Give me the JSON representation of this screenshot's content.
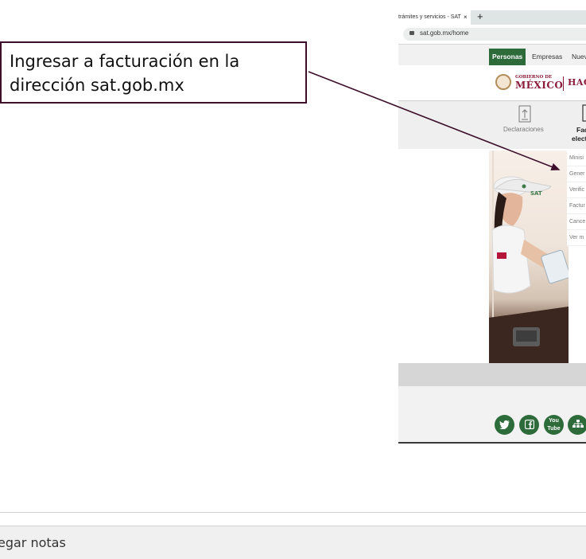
{
  "callout": {
    "line1": "Ingresar a facturación en la",
    "line2": "dirección sat.gob.mx"
  },
  "browser": {
    "tab_title": "trámites y servicios - SAT",
    "tab_close": "×",
    "new_tab": "+",
    "url": "sat.gob.mx/home"
  },
  "site": {
    "top_links": [
      "Personas",
      "Empresas",
      "Nuev"
    ],
    "gov_line1": "GOBIERNO DE",
    "gov_line2": "MÉXICO",
    "agency": "HAC",
    "menu": {
      "declaraciones": "Declaraciones",
      "factura_line1": "Fac",
      "factura_line2": "elect"
    },
    "dropdown_items": [
      "Minisi",
      "Gener",
      "Verific",
      "Factur",
      "Cance",
      "Ver m"
    ],
    "social": [
      "twitter-icon",
      "facebook-icon",
      "youtube-icon",
      "sitemap-icon"
    ],
    "social_youtube_text": "You Tube"
  },
  "notes_bar": {
    "label": "egar notas"
  },
  "colors": {
    "callout_border": "#3d0f2a",
    "arrow": "#3d0f2a",
    "sat_green": "#2e6b3a",
    "gov_maroon": "#8a1c3a"
  }
}
